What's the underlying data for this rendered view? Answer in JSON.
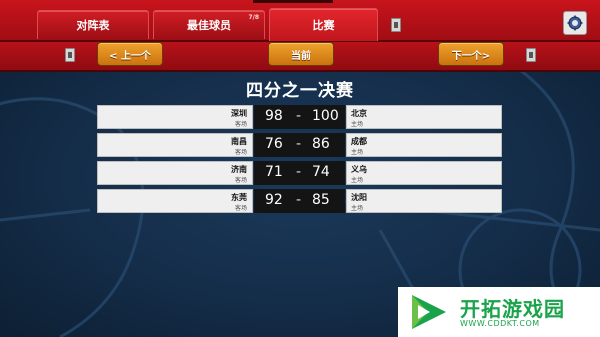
{
  "tabs": [
    {
      "label": "对阵表"
    },
    {
      "label": "最佳球员",
      "badge": "7/8"
    },
    {
      "label": "比赛"
    }
  ],
  "nav": {
    "prev_label": "< 上一个",
    "current_label": "当前",
    "next_label": "下一个>"
  },
  "round_title": "四分之一决赛",
  "matches": [
    {
      "home": "深圳",
      "home_tag": "客场",
      "home_score": "98",
      "dash": "-",
      "away_score": "100",
      "away": "北京",
      "away_tag": "主场"
    },
    {
      "home": "南昌",
      "home_tag": "客场",
      "home_score": "76",
      "dash": "-",
      "away_score": "86",
      "away": "成都",
      "away_tag": "主场"
    },
    {
      "home": "济南",
      "home_tag": "客场",
      "home_score": "71",
      "dash": "-",
      "away_score": "74",
      "away": "义乌",
      "away_tag": "主场"
    },
    {
      "home": "东莞",
      "home_tag": "客场",
      "home_score": "92",
      "dash": "-",
      "away_score": "85",
      "away": "沈阳",
      "away_tag": "主场"
    }
  ],
  "watermark": {
    "text": "开拓游戏园",
    "url": "WWW.CDDKT.COM"
  },
  "colors": {
    "topbar_red": "#c9141c",
    "button_orange": "#e08a1e",
    "background_navy": "#142d49",
    "score_black": "#141414",
    "watermark_green": "#1aa34a"
  }
}
